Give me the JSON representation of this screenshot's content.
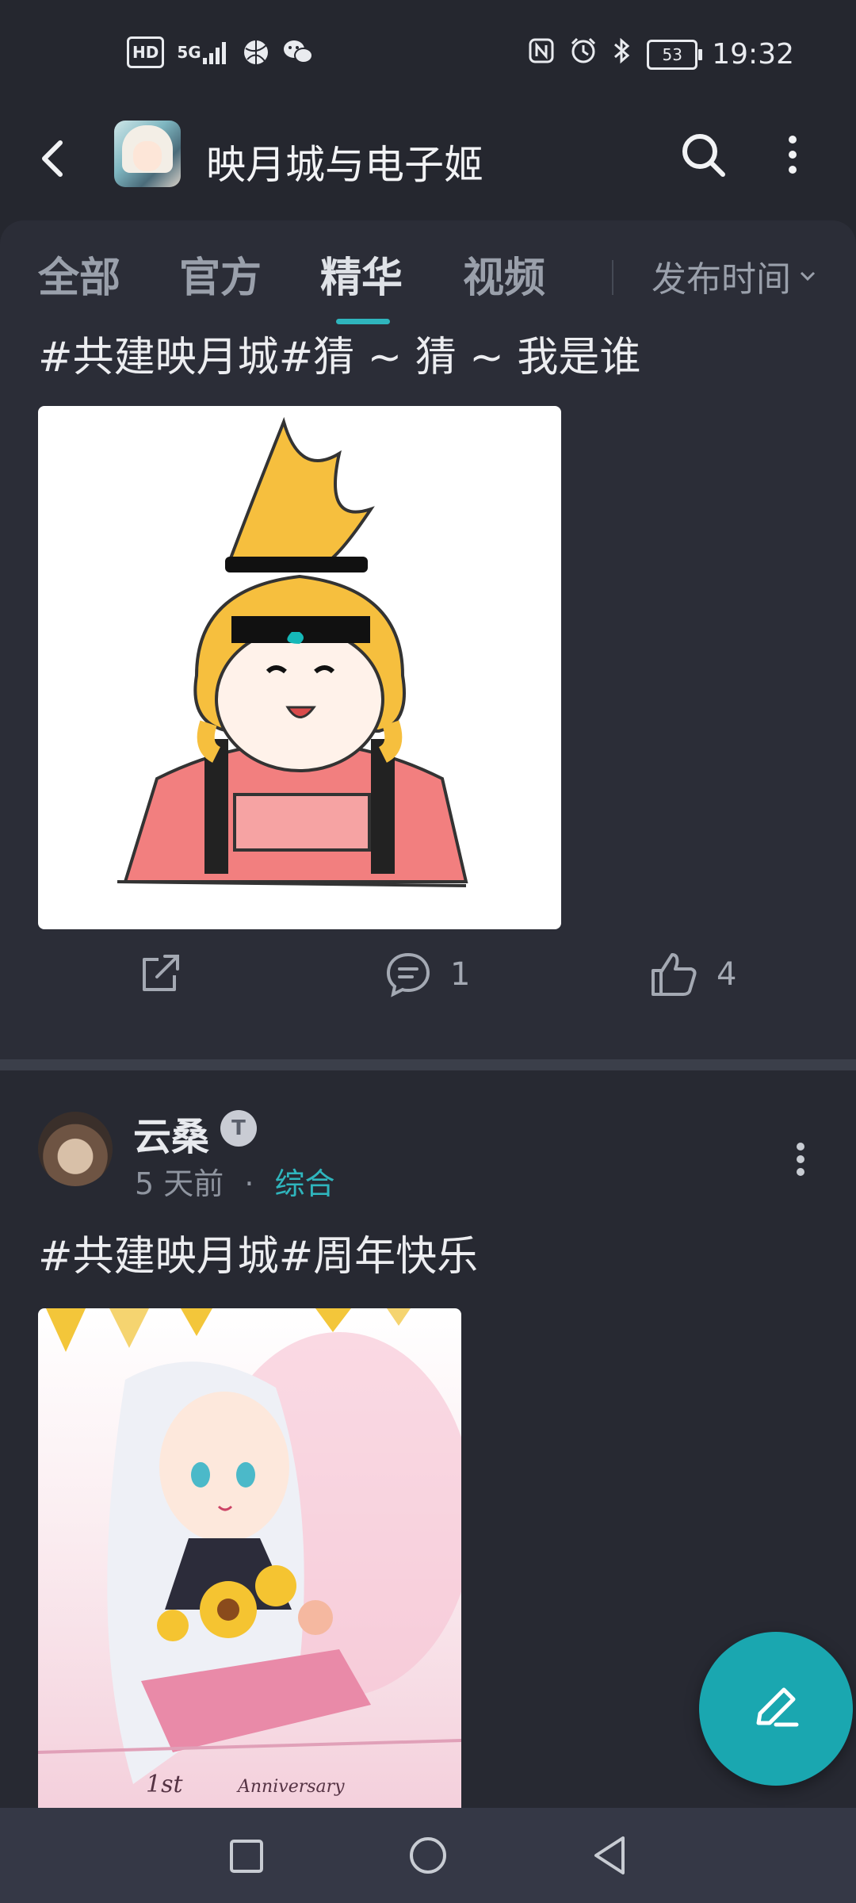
{
  "status_bar": {
    "left_icons": [
      "hd-icon",
      "signal-5g-icon",
      "basketball-app-icon",
      "wechat-icon"
    ],
    "hd_label": "HD",
    "network_label": "5G",
    "battery_level": "53",
    "time": "19:32",
    "right_icons": [
      "nfc-icon",
      "alarm-icon",
      "bluetooth-icon",
      "battery-icon"
    ]
  },
  "app_bar": {
    "title": "映月城与电子姬",
    "back_icon": "chevron-left-icon",
    "search_icon": "search-icon",
    "more_icon": "more-vertical-icon"
  },
  "tabs": {
    "items": [
      {
        "label": "全部"
      },
      {
        "label": "官方"
      },
      {
        "label": "精华"
      },
      {
        "label": "视频"
      }
    ],
    "active_index": 2,
    "sort_label": "发布时间"
  },
  "post1": {
    "title": "#共建映月城#猜 ~ 猜 ~ 我是谁",
    "comments": "1",
    "likes": "4"
  },
  "post2": {
    "username": "云桑",
    "badge": "T",
    "time_ago": "5 天前",
    "dot": "·",
    "category": "综合",
    "title": "#共建映月城#周年快乐",
    "image_text_1": "1st",
    "image_text_2": "Anniversary"
  },
  "colors": {
    "background": "#25272f",
    "card": "#2b2d37",
    "accent": "#2fb5bd",
    "fab": "#1aa7b0"
  },
  "nav_bar": {
    "icons": [
      "recent-apps-icon",
      "home-icon",
      "back-triangle-icon"
    ]
  }
}
